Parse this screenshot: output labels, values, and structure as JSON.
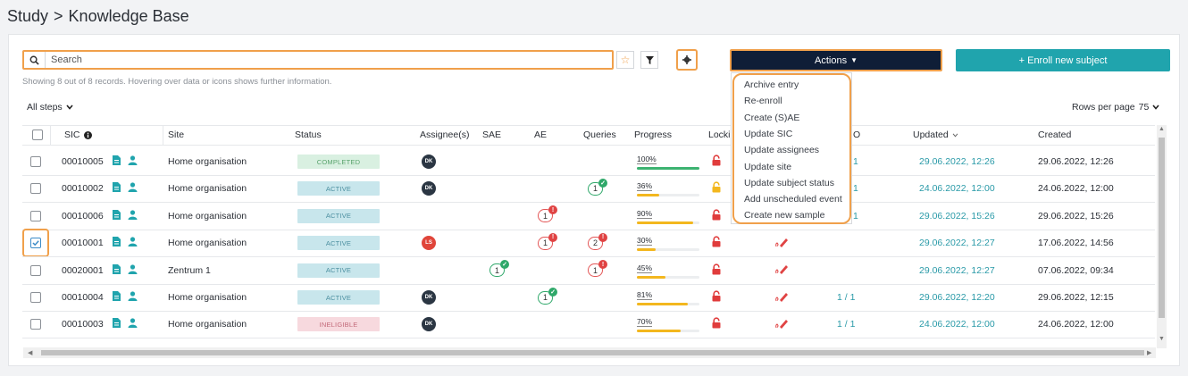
{
  "breadcrumb": {
    "parent": "Study",
    "separator": ">",
    "current": "Knowledge Base"
  },
  "search": {
    "placeholder": "Search"
  },
  "toolbar": {
    "actions_label": "Actions",
    "enroll_label": "+ Enroll new subject"
  },
  "info_text": "Showing 8 out of 8 records. Hovering over data or icons shows further information.",
  "filter": {
    "steps_label": "All steps"
  },
  "pagination": {
    "rows_per_page_label": "Rows per page",
    "rows_per_page_value": "75"
  },
  "columns": {
    "sic": "SIC",
    "site": "Site",
    "status": "Status",
    "assignees": "Assignee(s)",
    "sae": "SAE",
    "ae": "AE",
    "queries": "Queries",
    "progress": "Progress",
    "locking": "Locki",
    "o": "O",
    "updated": "Updated",
    "created": "Created"
  },
  "actions_menu": [
    "Archive entry",
    "Re-enroll",
    "Create (S)AE",
    "Update SIC",
    "Update assignees",
    "Update site",
    "Update subject status",
    "Add unscheduled event",
    "Create new sample"
  ],
  "rows": [
    {
      "sic": "00010005",
      "site": "Home organisation",
      "status": "COMPLETED",
      "assignee": "DK",
      "sae": "",
      "ae": "",
      "queries": "",
      "progress": "100%",
      "progress_value": 100,
      "lock": "red",
      "o": "1",
      "updated": "29.06.2022, 12:26",
      "created": "29.06.2022, 12:26"
    },
    {
      "sic": "00010002",
      "site": "Home organisation",
      "status": "ACTIVE",
      "assignee": "DK",
      "sae": "",
      "ae": "",
      "queries": "1",
      "progress": "36%",
      "progress_value": 36,
      "lock": "yellow",
      "o": "1",
      "updated": "24.06.2022, 12:00",
      "created": "24.06.2022, 12:00"
    },
    {
      "sic": "00010006",
      "site": "Home organisation",
      "status": "ACTIVE",
      "assignee": "",
      "sae": "",
      "ae": "1",
      "queries": "",
      "progress": "90%",
      "progress_value": 90,
      "lock": "red",
      "o": "1",
      "updated": "29.06.2022, 15:26",
      "created": "29.06.2022, 15:26"
    },
    {
      "sic": "00010001",
      "site": "Home organisation",
      "status": "ACTIVE",
      "assignee": "LS",
      "sae": "",
      "ae": "1",
      "queries": "2",
      "progress": "30%",
      "progress_value": 30,
      "lock": "red",
      "o": "",
      "updated": "29.06.2022, 12:27",
      "created": "17.06.2022, 14:56"
    },
    {
      "sic": "00020001",
      "site": "Zentrum 1",
      "status": "ACTIVE",
      "assignee": "",
      "sae": "1",
      "ae": "",
      "queries": "1",
      "progress": "45%",
      "progress_value": 45,
      "lock": "red",
      "o": "",
      "updated": "29.06.2022, 12:27",
      "created": "07.06.2022, 09:34"
    },
    {
      "sic": "00010004",
      "site": "Home organisation",
      "status": "ACTIVE",
      "assignee": "DK",
      "sae": "",
      "ae": "1",
      "queries": "",
      "progress": "81%",
      "progress_value": 81,
      "lock": "red",
      "o": "1 / 1",
      "updated": "29.06.2022, 12:20",
      "created": "29.06.2022, 12:15"
    },
    {
      "sic": "00010003",
      "site": "Home organisation",
      "status": "INELIGIBLE",
      "assignee": "DK",
      "sae": "",
      "ae": "",
      "queries": "",
      "progress": "70%",
      "progress_value": 70,
      "lock": "red",
      "o": "1 / 1",
      "updated": "24.06.2022, 12:00",
      "created": "24.06.2022, 12:00"
    }
  ],
  "colors": {
    "accent_orange": "#f0a04b",
    "navy": "#0f1e37",
    "teal": "#20a4ad",
    "lock_red": "#e03c3c",
    "lock_yellow": "#f3b71e"
  }
}
